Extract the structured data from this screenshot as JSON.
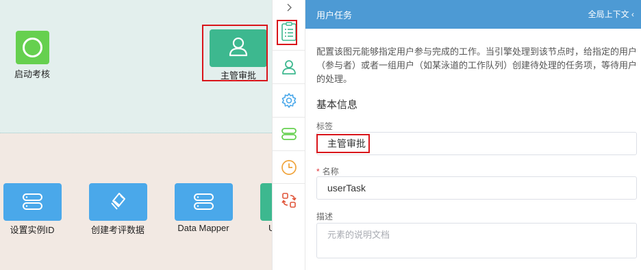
{
  "canvas": {
    "start_label": "启动考核",
    "user_task_label": "主管审批",
    "service_tasks": [
      {
        "label": "设置实例ID"
      },
      {
        "label": "创建考评数据"
      },
      {
        "label": "Data Mapper"
      },
      {
        "label": "U"
      }
    ]
  },
  "toolbar": {
    "collapse_glyph": ">",
    "icons": [
      "list-icon",
      "user-icon",
      "gear-icon",
      "service-icon",
      "clock-icon",
      "script-icon"
    ],
    "colors": {
      "list": "#3db88f",
      "user": "#3db88f",
      "gear": "#4aa8ea",
      "service": "#66d04f",
      "clock": "#f0a33a",
      "script": "#e0553a"
    }
  },
  "panel": {
    "title": "用户任务",
    "global_context": "全局上下文 ‹",
    "description": "配置该图元能够指定用户参与完成的工作。当引擎处理到该节点时，给指定的用户（参与者）或者一组用户（如某泳道的工作队列）创建待处理的任务项，等待用户的处理。",
    "section_title": "基本信息",
    "label_field": {
      "label": "标签",
      "value": "主管审批"
    },
    "name_field": {
      "required_mark": "*",
      "label": "名称",
      "value": "userTask"
    },
    "desc_field": {
      "label": "描述",
      "placeholder": "元素的说明文档"
    }
  },
  "colors": {
    "header": "#4d9ad4",
    "highlight": "#d9141a"
  }
}
